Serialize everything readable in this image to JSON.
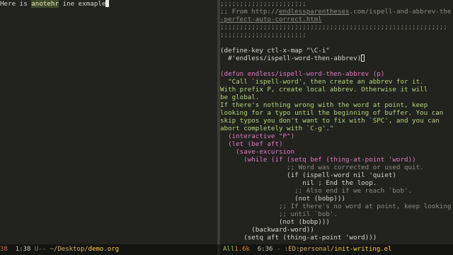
{
  "left_pane": {
    "text_prefix": "Here is ",
    "text_highlight": "anotehr",
    "text_suffix": " ine exmaple"
  },
  "right_pane": {
    "lines": [
      ";;;;;;;;;;;;;;;;;;;;;;",
      ";; From http://",
      "endlessparentheses",
      ".com/ispell-and-abbrev-the",
      "-perfect-auto-correct.html",
      ";;;;;;;;;;;;;;;;;;;;;;;;;;;;;;;;;;;;;;;;;;;;;;;;;;;;;;;;;;",
      ";;;;;;;;;;;;;;;;;;;;;;",
      "(define-key ctl-x-map \"\\C-i\"",
      "  #'endless/ispell-word-then-abbrev)",
      "(defun endless/ispell-word-then-abbrev (p)",
      "  \"Call `ispell-word', then create an abbrev for it.",
      "With prefix P, create local abbrev. Otherwise it will",
      "be global.",
      "If there's nothing wrong with the word at point, keep",
      "looking for a typo until the beginning of buffer. You can",
      "skip typos you don't want to fix with `SPC', and you can",
      "abort completely with `C-g'.\"",
      "  (interactive \"P\")",
      "  (let (bef aft)",
      "    (save-excursion",
      "      (while (if (setq bef (thing-at-point 'word))",
      "                 ;; Word was corrected or used quit.",
      "                 (if (ispell-word nil 'quiet)",
      "                     nil ; End the loop.",
      "                   ;; Also end if we reach `bob'.",
      "                   (not (bobp)))",
      "               ;; If there's no word at point, keep looking",
      "               ;; until `bob'.",
      "               (not (bobp)))",
      "        (backward-word))",
      "      (setq aft (thing-at-point 'word)))"
    ]
  },
  "modeline_left": {
    "num": "38",
    "pos": "1:38",
    "state": "U--",
    "path": "~/Desktop/",
    "file": "demo.org"
  },
  "modeline_right": {
    "pos_label": "All",
    "size": "1.6k",
    "pos": "6:36",
    "state": "-",
    "flags": ":ED:personal/",
    "file": "init-writing.el"
  }
}
